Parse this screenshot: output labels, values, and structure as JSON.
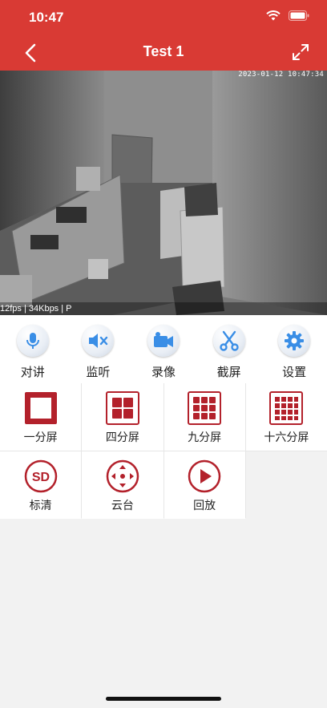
{
  "status": {
    "time": "10:47"
  },
  "header": {
    "title": "Test 1"
  },
  "video": {
    "timestamp": "2023-01-12 10:47:34",
    "stats": "12fps | 34Kbps | P"
  },
  "tools": [
    {
      "label": "对讲",
      "icon": "microphone-icon"
    },
    {
      "label": "监听",
      "icon": "speaker-mute-icon"
    },
    {
      "label": "录像",
      "icon": "video-camera-icon"
    },
    {
      "label": "截屏",
      "icon": "scissors-icon"
    },
    {
      "label": "设置",
      "icon": "gear-icon"
    }
  ],
  "grid": [
    {
      "label": "一分屏",
      "icon": "single-screen-icon"
    },
    {
      "label": "四分屏",
      "icon": "four-screen-icon"
    },
    {
      "label": "九分屏",
      "icon": "nine-screen-icon"
    },
    {
      "label": "十六分屏",
      "icon": "sixteen-screen-icon"
    },
    {
      "label": "标清",
      "icon": "sd-icon"
    },
    {
      "label": "云台",
      "icon": "ptz-arrows-icon"
    },
    {
      "label": "回放",
      "icon": "playback-icon"
    }
  ],
  "colors": {
    "header": "#d93a34",
    "accent_red": "#b3212b",
    "tool_blue": "#3a8ee6"
  }
}
